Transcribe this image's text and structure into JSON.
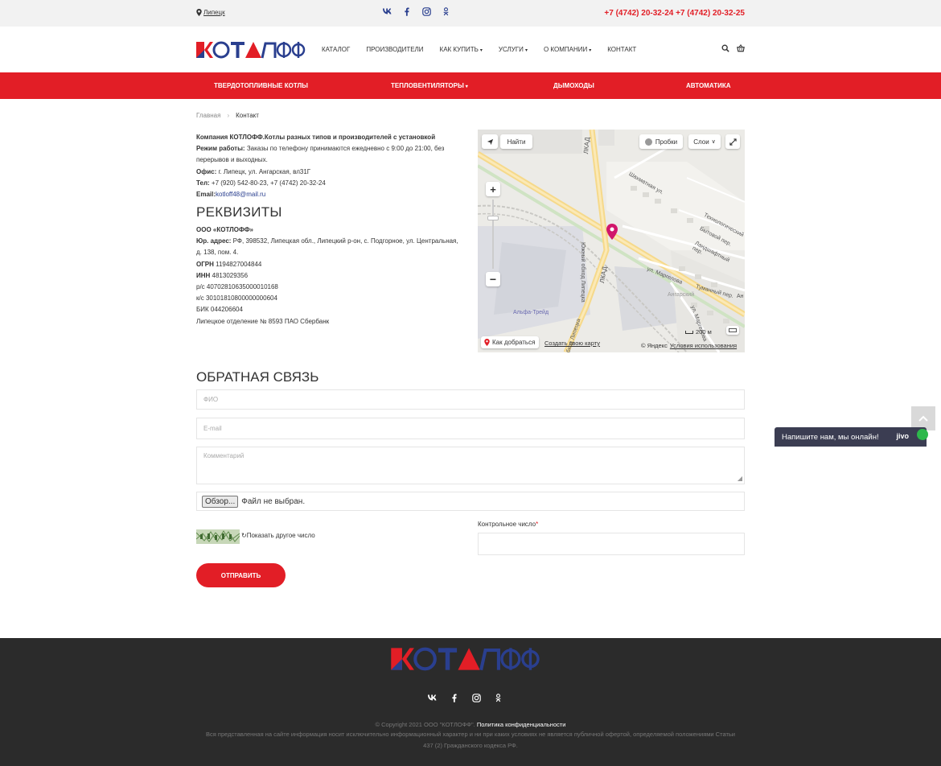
{
  "topbar": {
    "city": "Липецк",
    "phones": "+7 (4742) 20-32-24 +7 (4742) 20-32-25"
  },
  "header": {
    "nav": [
      {
        "label": "КАТАЛОГ"
      },
      {
        "label": "ПРОИЗВОДИТЕЛИ"
      },
      {
        "label": "КАК КУПИТЬ"
      },
      {
        "label": "УСЛУГИ"
      },
      {
        "label": "О КОМПАНИИ"
      },
      {
        "label": "КОНТАКТ"
      }
    ]
  },
  "rednav": [
    {
      "label": "ТВЕРДОТОПЛИВНЫЕ КОТЛЫ"
    },
    {
      "label": "ТЕПЛОВЕНТИЛЯТОРЫ"
    },
    {
      "label": "ДЫМОХОДЫ"
    },
    {
      "label": "АВТОМАТИКА"
    }
  ],
  "breadcrumb": {
    "home": "Главная",
    "current": "Контакт"
  },
  "contact": {
    "company": "Компания КОТЛОФФ.Котлы разных типов и производителей с установкой",
    "hours_label": "Режим работы:",
    "hours": " Заказы по телефону принимаются ежедневно с 9:00 до 21:00, без перерывов и выходных.",
    "office_label": "Офис:",
    "office": " г. Липецк, ул. Ангарская, вл31Г",
    "tel_label": "Тел:",
    "tel": " +7 (920) 542-80-23, +7 (4742) 20-32-24",
    "email_label": "Email:",
    "email": "kotloff48@mail.ru"
  },
  "requisites": {
    "title": "РЕКВИЗИТЫ",
    "org": "ООО «КОТЛОФФ»",
    "addr_label": "Юр. адрес:",
    "addr": " РФ, 398532, Липецкая обл., Липецкий р-он, с. Подгорное, ул. Центральная, д. 138, пом. 4.",
    "ogrn_label": "ОГРН",
    "ogrn": " 1194827004844",
    "inn_label": "ИНН",
    "inn": " 4813029356",
    "rs": "р/с 40702810635000010168",
    "ks": "к/с 30101810800000000604",
    "bik": "БИК 044206604",
    "bank": "Липецкое отделение № 8593 ПАО Сбербанк"
  },
  "map": {
    "find": "Найти",
    "traffic": "Пробки",
    "layers": "Слои",
    "route": "Как добраться",
    "create": "Создать свою карту",
    "copyright": "© Яндекс",
    "terms": "Условия использования",
    "scale": "200 м",
    "labels": {
      "lkad1": "ЛКАД",
      "lkad2": "ЛКАД",
      "south": "Южный обход Липецка",
      "south2": "обход Липецка",
      "shakh": "Шахматная ул.",
      "tech": "Технологический",
      "byt": "Бытовой пер.",
      "land": "Ландшафтный пер.",
      "marg": "ул. Маргелова",
      "tum": "Туманный пер.",
      "ang": "Ангарский",
      "marg2": "ул. Маргелова",
      "alfa": "Альфа-Трейд",
      "an": "Ан"
    }
  },
  "feedback": {
    "title": "ОБРАТНАЯ СВЯЗЬ",
    "fio": "ФИО",
    "email": "E-mail",
    "comment": "Комментарий",
    "file_button": "Обзор...",
    "file_status": "Файл не выбран.",
    "captcha_refresh": "Показать другое число",
    "control_label": "Контрольное число",
    "submit": "ОТПРАВИТЬ"
  },
  "chat": {
    "text": "Напишите нам, мы онлайн!",
    "brand": "jivo"
  },
  "footer": {
    "copyright": "© Copyright 2021 ООО \"КОТЛОФФ\". ",
    "policy": "Политика конфиденциальности",
    "disclaimer": "Вся представленная на сайте информация носит исключительно информационный характер и ни при каких условиях не является публичной офертой, определяемой положениями Статьи 437 (2) Гражданского кодекса РФ."
  },
  "colors": {
    "brand_red": "#e21e26",
    "brand_blue": "#2a3f8f",
    "footer_bg": "#2b2b2b"
  },
  "icons": [
    "map-pin-icon",
    "vk-icon",
    "facebook-icon",
    "instagram-icon",
    "odnoklassniki-icon",
    "search-icon",
    "basket-icon",
    "location-arrow-icon",
    "fullscreen-icon",
    "chevron-up-icon"
  ]
}
